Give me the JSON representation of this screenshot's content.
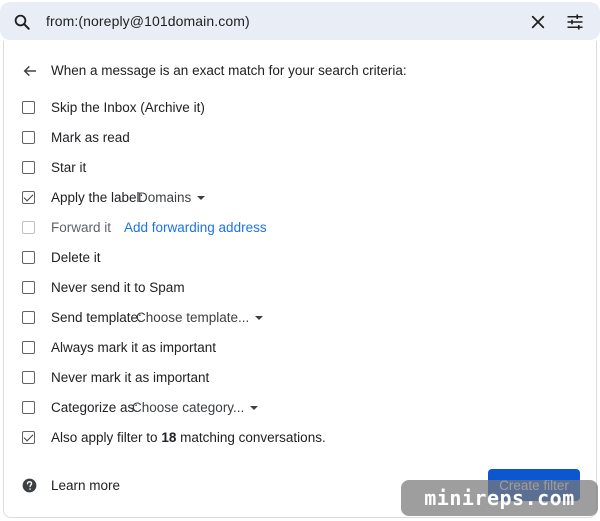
{
  "search": {
    "query": "from:(noreply@101domain.com)",
    "icon": "search-icon",
    "clear_icon": "close-icon",
    "options_icon": "tune-icon"
  },
  "heading": "When a message is an exact match for your search criteria:",
  "options": {
    "skip_inbox": "Skip the Inbox (Archive it)",
    "mark_read": "Mark as read",
    "star": "Star it",
    "apply_label": "Apply the label:",
    "apply_label_value": "Domains",
    "forward": "Forward it",
    "forward_link": "Add forwarding address",
    "delete": "Delete it",
    "never_spam": "Never send it to Spam",
    "send_template": "Send template:",
    "send_template_value": "Choose template...",
    "always_important": "Always mark it as important",
    "never_important": "Never mark it as important",
    "categorize": "Categorize as:",
    "categorize_value": "Choose category...",
    "also_apply_prefix": "Also apply filter to",
    "also_apply_count": "18",
    "also_apply_suffix": "matching conversations."
  },
  "checked": {
    "apply_label": true,
    "also_apply": true
  },
  "footer": {
    "learn_more": "Learn more",
    "create_filter": "Create filter"
  },
  "watermark": "minireps.com",
  "colors": {
    "accent": "#0b57d0",
    "link": "#1a73e8",
    "search_bg": "#e9eef6"
  }
}
